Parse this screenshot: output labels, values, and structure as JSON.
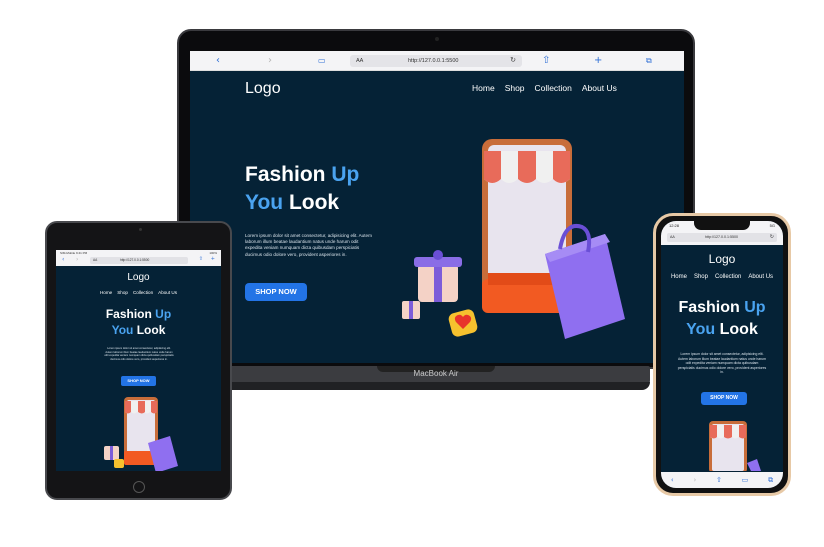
{
  "laptop": {
    "brand_label": "MacBook Air",
    "browser": {
      "text_size_label": "AA",
      "url": "http://127.0.0.1:5500",
      "reload_icon": "reload-icon",
      "back_icon": "chevron-left-icon",
      "forward_icon": "chevron-right-icon",
      "bookmarks_icon": "book-icon",
      "share_icon": "share-icon",
      "new_tab_icon": "plus-icon",
      "tabs_icon": "tabs-icon"
    }
  },
  "tablet": {
    "status_left": "SIM-Mobile 9:41 PM",
    "status_right": "100%",
    "text_size_label": "AA",
    "url": "http://127.0.0.1:5500"
  },
  "phone": {
    "status_time": "12:28",
    "status_right": "5G",
    "text_size_label": "AA",
    "url": "http://127.0.0.1:5500"
  },
  "site": {
    "logo": "Logo",
    "nav": [
      "Home",
      "Shop",
      "Collection",
      "About Us"
    ],
    "hero_title_line1_a": "Fashion ",
    "hero_title_line1_b": "Up",
    "hero_title_line2_a": "You",
    "hero_title_line2_b": " Look",
    "hero_paragraph": "Lorem ipsum dolor sit amet consectetur, adipisicing elit. Autem laborum illum beatae laudantium natus unde harum odit expedita veniam numquam dicta quibusdam perspiciatis ducimus odio dolore vero, provident asperiores in.",
    "cta_label": "SHOP NOW"
  },
  "colors": {
    "background": "#052236",
    "accent": "#4aa3f0",
    "button": "#2374e6"
  }
}
